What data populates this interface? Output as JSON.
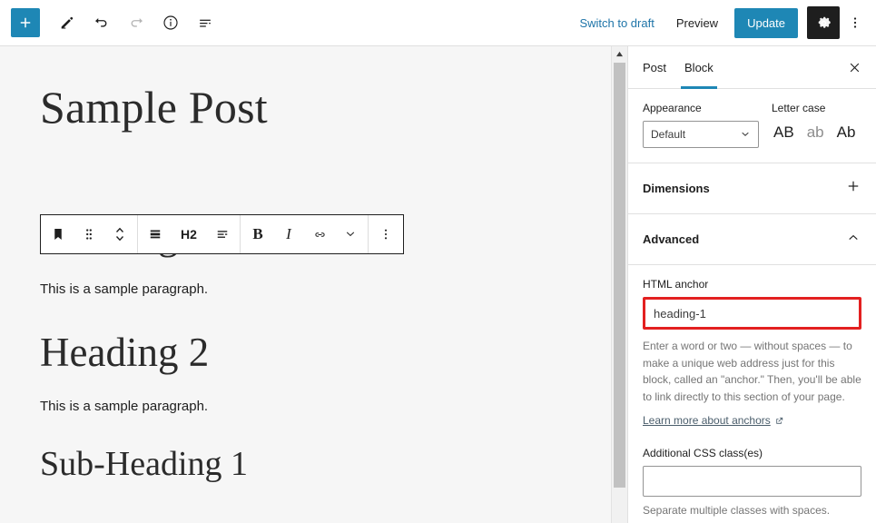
{
  "header": {
    "add_block_icon": "plus-icon",
    "edit_icon": "pencil-icon",
    "undo_icon": "undo-icon",
    "redo_icon": "redo-icon",
    "info_icon": "info-icon",
    "list_view_icon": "list-view-icon",
    "switch_to_draft_label": "Switch to draft",
    "preview_label": "Preview",
    "update_label": "Update",
    "settings_icon": "gear-icon",
    "options_icon": "kebab-menu-icon",
    "accent_color": "#1e87b5",
    "link_color": "#1e74a8"
  },
  "block_toolbar": {
    "block_type_icon": "bookmark-icon",
    "drag_icon": "drag-handle-icon",
    "move_icon": "move-up-down-icon",
    "heading_level_icon": "heading-level-icon",
    "heading_level_label": "H2",
    "align_icon": "align-text-icon",
    "bold_label": "B",
    "italic_label": "I",
    "link_icon": "link-icon",
    "more_formats_icon": "chevron-down-icon",
    "options_icon": "kebab-menu-icon"
  },
  "canvas": {
    "post_title": "Sample Post",
    "blocks": [
      {
        "type": "h1",
        "text": "Heading 1"
      },
      {
        "type": "p",
        "text": "This is a sample paragraph."
      },
      {
        "type": "h2",
        "text": "Heading 2"
      },
      {
        "type": "p",
        "text": "This is a sample paragraph."
      },
      {
        "type": "h3",
        "text": "Sub-Heading 1"
      }
    ],
    "background_color": "#f6f6f6"
  },
  "sidebar": {
    "tabs": [
      {
        "label": "Post",
        "active": false
      },
      {
        "label": "Block",
        "active": true
      }
    ],
    "close_icon": "close-icon",
    "typography": {
      "appearance_label": "Appearance",
      "appearance_value": "Default",
      "appearance_caret_icon": "chevron-down-icon",
      "letter_case_label": "Letter case",
      "letter_case_options": [
        {
          "label": "AB",
          "dim": false
        },
        {
          "label": "ab",
          "dim": true
        },
        {
          "label": "Ab",
          "dim": false
        }
      ]
    },
    "dimensions": {
      "title": "Dimensions",
      "toggle_icon": "plus-icon"
    },
    "advanced": {
      "title": "Advanced",
      "toggle_icon": "chevron-up-icon",
      "html_anchor_label": "HTML anchor",
      "html_anchor_value": "heading-1",
      "html_anchor_help": "Enter a word or two — without spaces — to make a unique web address just for this block, called an \"anchor.\" Then, you'll be able to link directly to this section of your page.",
      "learn_more_label": "Learn more about anchors",
      "external_link_icon": "external-link-icon",
      "css_classes_label": "Additional CSS class(es)",
      "css_classes_value": "",
      "css_classes_help": "Separate multiple classes with spaces."
    },
    "annotation_color": "#e32020"
  },
  "scrollbar": {
    "up_arrow_icon": "scroll-up-arrow-icon"
  }
}
